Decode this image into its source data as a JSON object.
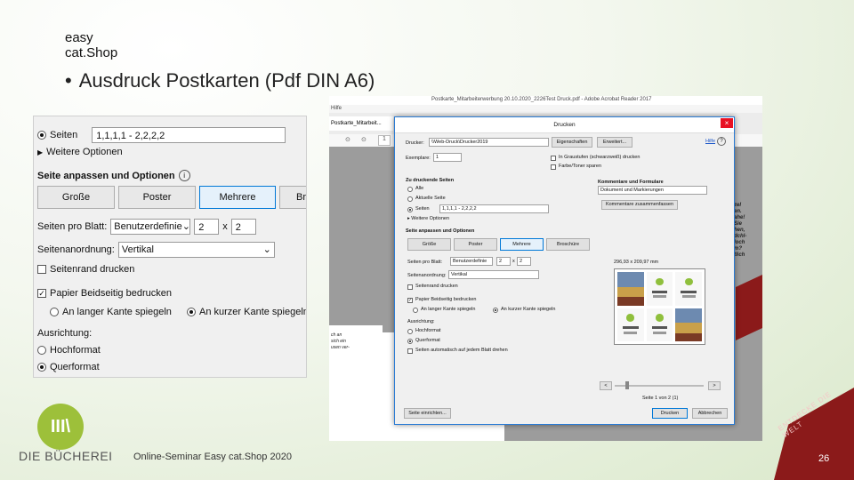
{
  "slide": {
    "brand_line1": "easy",
    "brand_line2": "cat.Shop",
    "title_bullet": "•",
    "title": "Ausdruck Postkarten (Pdf DIN A6)",
    "footer": "Online-Seminar Easy cat.Shop 2020",
    "page_number": "26",
    "logo_text": "DIE BÜCHEREI",
    "logo_mark": "III\\",
    "corner_text": "ENTDECKE DIE WELT",
    "colors": {
      "accent_green": "#9dc03a",
      "accent_red": "#8b1a1a",
      "dialog_blue": "#2a7bd4"
    }
  },
  "zoom_panel": {
    "pages_label": "Seiten",
    "pages_value": "1,1,1,1 - 2,2,2,2",
    "more_options": "Weitere Optionen",
    "section_title": "Seite anpassen und Optionen",
    "info_icon": "info-icon",
    "buttons": [
      "Große",
      "Poster",
      "Mehrere",
      "Br"
    ],
    "pages_per_sheet_label": "Seiten pro Blatt:",
    "pages_per_sheet_value": "Benutzerdefinie",
    "pages_x": "2",
    "pages_x_sep": "x",
    "pages_y": "2",
    "order_label": "Seitenanordnung:",
    "order_value": "Vertikal",
    "print_border": "Seitenrand drucken",
    "duplex": "Papier Beidseitig bedrucken",
    "long_edge": "An langer Kante spiegeln",
    "short_edge": "An kurzer Kante spiegeln",
    "orientation_label": "Ausrichtung:",
    "portrait": "Hochformat",
    "landscape": "Querformat"
  },
  "acrobat": {
    "window_title": "Postkarte_Mitarbeiterwerbung 20.10.2020_2226Test Druck.pdf - Adobe Acrobat Reader 2017",
    "menu_help": "Hilfe",
    "tab_label": "Postkarte_Mitarbeit...",
    "page_field": "1",
    "side_text": [
      "zel",
      "en.",
      "ahe!",
      "Sie",
      "hen,",
      "dchl-",
      "loch",
      "m?",
      "tlich"
    ],
    "page_text": [
      "ch an",
      "sich ein",
      "usen ver-"
    ]
  },
  "print_dialog": {
    "title": "Drucken",
    "close": "×",
    "printer_label": "Drucker:",
    "printer_value": "\\\\Web-Druck\\Drucker2019",
    "properties_btn": "Eigenschaften",
    "advanced_btn": "Erweitert...",
    "help_link": "Hilfe",
    "help_icon": "help-icon",
    "copies_label": "Exemplare:",
    "copies_value": "1",
    "grayscale": "In Graustufen (schwarzweiß) drucken",
    "save_ink": "Farbe/Toner sparen",
    "pages_section": "Zu druckende Seiten",
    "all": "Alle",
    "current_page": "Aktuelle Seite",
    "pages": "Seiten",
    "pages_value": "1,1,1,1 - 2,2,2,2",
    "more_options": "Weitere Optionen",
    "fit_section": "Seite anpassen und Optionen",
    "size_buttons": [
      "Größe",
      "Poster",
      "Mehrere",
      "Broschüre"
    ],
    "per_sheet_label": "Seiten pro Blatt:",
    "per_sheet_value": "Benutzerdefinie",
    "x_value": "2",
    "x_sep": "x",
    "y_value": "2",
    "order_label": "Seitenanordnung:",
    "order_value": "Vertikal",
    "print_border": "Seitenrand drucken",
    "duplex": "Papier Beidseitig bedrucken",
    "long_edge": "An langer Kante spiegeln",
    "short_edge": "An kurzer Kante spiegeln",
    "orientation_label": "Ausrichtung:",
    "portrait": "Hochformat",
    "landscape": "Querformat",
    "auto_rotate": "Seiten automatisch auf jedem Blatt drehen",
    "comments_section": "Kommentare und Formulare",
    "comments_value": "Dokument und Markierungen",
    "summarize_btn": "Kommentare zusammenfassen",
    "paper_size": "296,93 x 209,97 mm",
    "page_indicator": "Seite 1 von 2 (1)",
    "prev": "<",
    "next": ">",
    "setup_btn": "Seite einrichten...",
    "print_btn": "Drucken",
    "cancel_btn": "Abbrechen"
  }
}
